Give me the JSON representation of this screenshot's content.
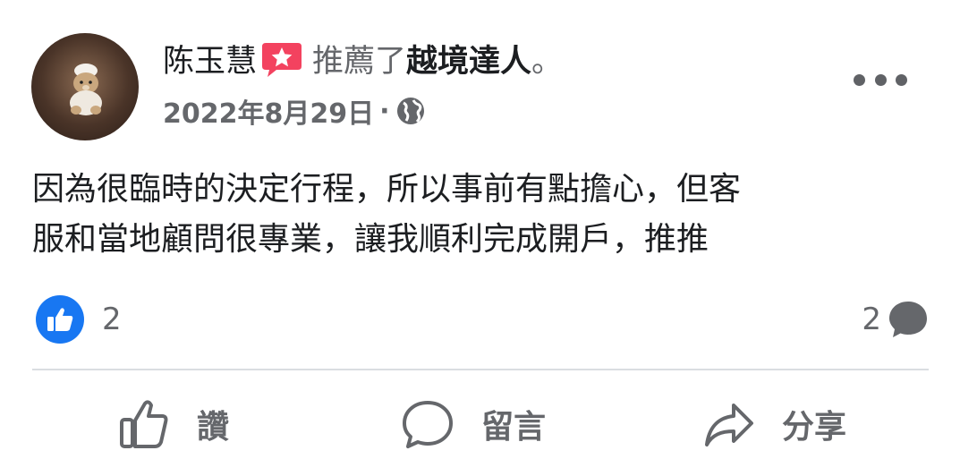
{
  "post": {
    "poster_name": "陈玉慧",
    "verb": "推薦了",
    "page_name": "越境達人",
    "period": "。",
    "date": "2022年8月29日",
    "separator": "·",
    "privacy_icon": "globe-icon",
    "body": "因為很臨時的決定行程，所以事前有點擔心，但客\n服和當地顧問很專業，讓我順利完成開戶，推推"
  },
  "badge": {
    "icon": "star-recommendation-icon",
    "color": "#f3425f"
  },
  "reactions": {
    "icon": "like-icon",
    "count": "2",
    "color": "#1877f2"
  },
  "comments": {
    "count": "2",
    "icon": "comment-bubble-icon"
  },
  "actions": [
    {
      "label": "讚",
      "icon": "thumbs-up-icon"
    },
    {
      "label": "留言",
      "icon": "comment-icon"
    },
    {
      "label": "分享",
      "icon": "share-icon"
    }
  ]
}
